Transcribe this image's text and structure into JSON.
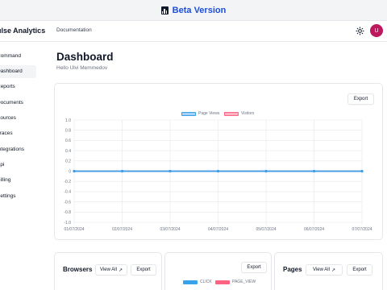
{
  "beta": {
    "label": "Beta Version"
  },
  "nav": {
    "brand": "Pulse Analytics",
    "doc_link": "Documentation",
    "avatar_initial": "U"
  },
  "sidebar": {
    "items": [
      {
        "label": "Command",
        "active": false
      },
      {
        "label": "Dashboard",
        "active": true
      },
      {
        "label": "Reports",
        "active": false
      },
      {
        "label": "Documents",
        "active": false
      },
      {
        "label": "Sources",
        "active": false
      },
      {
        "label": "Traces",
        "active": false
      },
      {
        "label": "Integrations",
        "active": false
      },
      {
        "label": "Api",
        "active": false
      },
      {
        "label": "Billing",
        "active": false
      },
      {
        "label": "Settings",
        "active": false
      }
    ]
  },
  "main": {
    "title": "Dashboard",
    "greeting": "Hello Ulvi Memmedov",
    "chart": {
      "export_label": "Export"
    },
    "browsers": {
      "title": "Browsers",
      "view_all": "View All",
      "export": "Export"
    },
    "events": {
      "export": "Export",
      "legend": [
        "CLICK",
        "PAGE_VIEW"
      ]
    },
    "pages": {
      "title": "Pages",
      "view_all": "View All",
      "export": "Export"
    }
  },
  "colors": {
    "page_views": "#36a2eb",
    "visitors": "#ff6384",
    "avatar": "#be185d",
    "beta_text": "#1d4ed8"
  },
  "chart_data": {
    "type": "line",
    "x": [
      "01/07/2024",
      "02/07/2024",
      "03/07/2024",
      "04/07/2024",
      "05/07/2024",
      "06/07/2024",
      "07/07/2024"
    ],
    "series": [
      {
        "name": "Page Views",
        "values": [
          0,
          0,
          0,
          0,
          0,
          0,
          0
        ],
        "color": "#36a2eb"
      },
      {
        "name": "Visitors",
        "values": [
          0,
          0,
          0,
          0,
          0,
          0,
          0
        ],
        "color": "#ff6384"
      }
    ],
    "yticks": [
      "1.0",
      "0.8",
      "0.6",
      "0.4",
      "0.2",
      "0",
      "-0.2",
      "-0.4",
      "-0.6",
      "-0.8",
      "-1.0"
    ],
    "ylim": [
      -1,
      1
    ],
    "grid": true,
    "legend": "top-center"
  }
}
